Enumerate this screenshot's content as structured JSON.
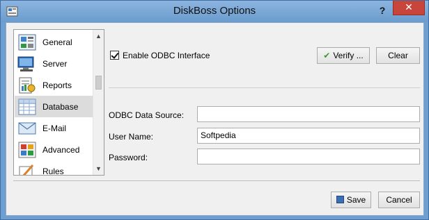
{
  "window": {
    "title": "DiskBoss Options",
    "help_label": "?",
    "close_label": "✕"
  },
  "sidebar": {
    "items": [
      {
        "label": "General",
        "icon": "general-icon"
      },
      {
        "label": "Server",
        "icon": "server-icon"
      },
      {
        "label": "Reports",
        "icon": "reports-icon"
      },
      {
        "label": "Database",
        "icon": "database-icon",
        "selected": true
      },
      {
        "label": "E-Mail",
        "icon": "email-icon"
      },
      {
        "label": "Advanced",
        "icon": "advanced-icon"
      },
      {
        "label": "Rules",
        "icon": "rules-icon"
      }
    ],
    "scroll_up": "▲",
    "scroll_down": "▼"
  },
  "database": {
    "enable_odbc_label": "Enable ODBC Interface",
    "enable_odbc_checked": true,
    "verify_label": "Verify ...",
    "clear_label": "Clear",
    "fields": [
      {
        "label": "ODBC Data Source:",
        "value": ""
      },
      {
        "label": "User Name:",
        "value": "Softpedia"
      },
      {
        "label": "Password:",
        "value": ""
      }
    ]
  },
  "footer": {
    "save_label": "Save",
    "cancel_label": "Cancel"
  },
  "colors": {
    "titlebar": "#7ba8d8",
    "close_button": "#c7453b",
    "panel_background": "#f0f0f0",
    "selected_item": "#dcdcdc"
  }
}
